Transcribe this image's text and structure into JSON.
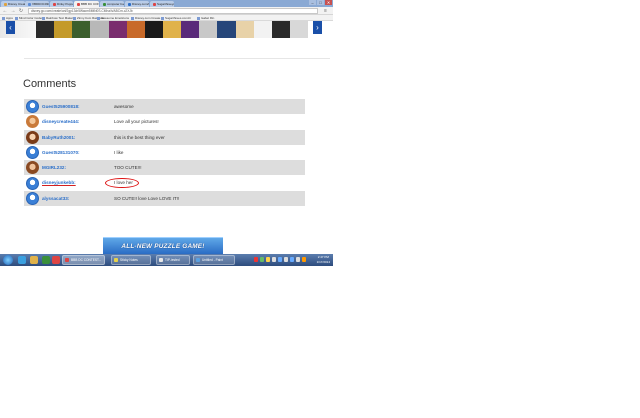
{
  "browser": {
    "tabs": [
      {
        "label": "Disney Create - Disney Cl",
        "color": "#e0a23c"
      },
      {
        "label": "VBDDOC03C5 for Andro",
        "color": "#5b8bd6"
      },
      {
        "label": "Dinky Puppets by Jade",
        "color": "#d44"
      },
      {
        "label": "BBB DC CONTEST WIN!!",
        "color": "#d44",
        "active": true
      },
      {
        "label": "computer bug png",
        "color": "#3a8f3a"
      },
      {
        "label": "Disney.com/Create",
        "color": "#2b6fc9"
      },
      {
        "label": "Sugarthreeyouree",
        "color": "#d44"
      }
    ],
    "window_buttons": {
      "minimize": "–",
      "maximize": "□",
      "close": "✕"
    },
    "url": "disney.go.com/create/art/2gp13dr5Wacm5MtN0S-CMha/h/ABCm-c2XJb",
    "back_icon": "←",
    "forward_icon": "→",
    "reload_icon": "↻",
    "menu_icon": "≡",
    "bookmarks": [
      "Apps",
      "Mind Color Codes",
      "Rainbow Text Maker",
      "Zinny.Com Rainbow",
      "Awesome Emoticons",
      "Disney.com Create",
      "Sugarthrees.com/cr",
      "Isabel Rin"
    ]
  },
  "carousel": {
    "prev_icon": "‹",
    "next_icon": "›",
    "thumb_colors": [
      "#2b2b2b",
      "#c49a2a",
      "#3c5f2d",
      "#b8b8b8",
      "#7a2d6e",
      "#c86a2a",
      "#1a1a1a",
      "#e0b24a",
      "#5a2a7a",
      "#c8c8c8",
      "#26467a",
      "#e8d2a8",
      "#f2f2f2",
      "#2a2a2a",
      "#d8d8d8"
    ]
  },
  "comments": {
    "title": "Comments",
    "items": [
      {
        "user": "Guest525900818:",
        "text": "awesome",
        "avatar": "guest"
      },
      {
        "user": "disneycreate444:",
        "text": "Love all your pictures!",
        "avatar": "photo1"
      },
      {
        "user": "BabyRuth2001:",
        "text": "this is the best thing ever",
        "avatar": "photo2"
      },
      {
        "user": "Guest528131070:",
        "text": "I like",
        "avatar": "guest"
      },
      {
        "user": "MGIRL232:",
        "text": "TOO CUTE!!!",
        "avatar": "photo3"
      },
      {
        "user": "disneyjunkebb:",
        "text": "I love her",
        "avatar": "guest"
      },
      {
        "user": "alyssacat33:",
        "text": "SO CUTE!! love Love LOVE IT!!",
        "avatar": "guest"
      }
    ]
  },
  "ad": {
    "label": "ALL-NEW PUZZLE GAME!"
  },
  "taskbar": {
    "tasks": [
      {
        "label": "BBB DC CONTEST...",
        "color": "#d44",
        "active": true
      },
      {
        "label": "Sticky Notes",
        "color": "#e8d24a"
      },
      {
        "label": "TIP-iested",
        "color": "#e8e8e8"
      },
      {
        "label": "Untitled - Paint",
        "color": "#5aa0e0"
      }
    ],
    "clock_time": "2:47 PM",
    "clock_date": "1/17/2014",
    "tray_colors": [
      "#e33",
      "#6b6",
      "#ffd24a",
      "#ddd",
      "#6af",
      "#ddd",
      "#6af",
      "#ddd",
      "#f90"
    ]
  }
}
